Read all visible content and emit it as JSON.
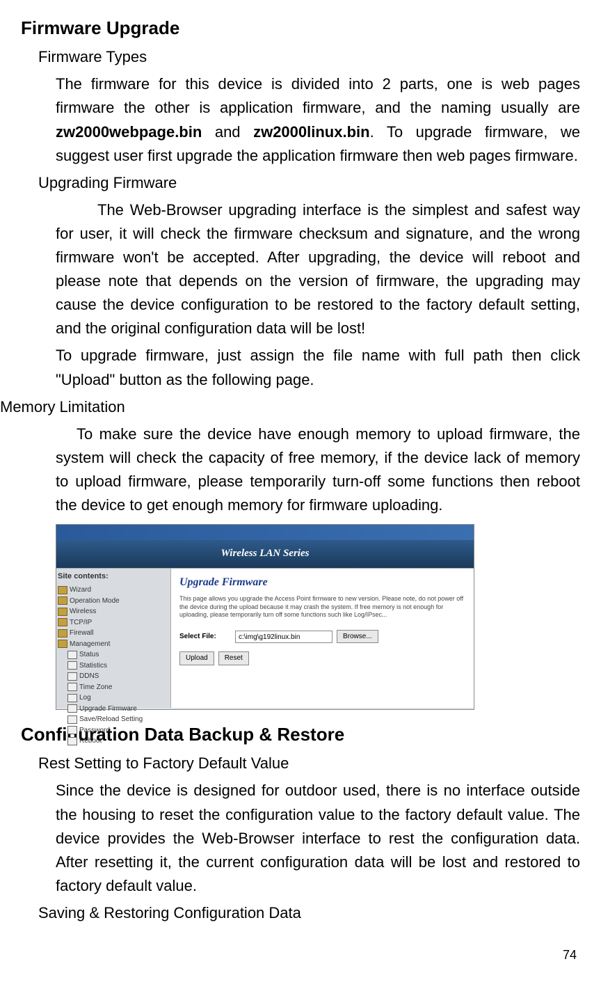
{
  "section1": {
    "title": "Firmware Upgrade",
    "sub1_title": "Firmware Types",
    "sub1_body": "The firmware for this device is divided into 2 parts, one is web pages firmware the other is application firmware, and the naming usually are ",
    "sub1_bold1": "zw2000webpage.bin",
    "sub1_mid": " and ",
    "sub1_bold2": "zw2000linux.bin",
    "sub1_end": ". To upgrade firmware, we suggest user first upgrade the application firmware then web pages firmware.",
    "sub2_title": "Upgrading Firmware",
    "sub2_body": "The Web-Browser upgrading interface is the simplest and safest way for user, it will check the firmware checksum and signature, and the wrong firmware won't be accepted. After upgrading, the device will reboot and please note that depends on the version of firmware, the upgrading may cause the device configuration to be restored to the factory default setting, and the original configuration data will be lost!",
    "sub2_body2": "To upgrade firmware, just assign the file name with full path then click \"Upload\" button as the following page.",
    "sub3_title": "Memory Limitation",
    "sub3_body": "To make sure the device have enough memory to upload firmware, the system will check the capacity of free memory, if the device lack of memory to upload firmware, please temporarily turn-off some functions then reboot the device to get enough memory for firmware uploading."
  },
  "screenshot": {
    "banner": "Wireless LAN Series",
    "sidebar_title": "Site contents:",
    "tree": {
      "wizard": "Wizard",
      "operation_mode": "Operation Mode",
      "wireless": "Wireless",
      "tcpip": "TCP/IP",
      "firewall": "Firewall",
      "management": "Management",
      "status": "Status",
      "statistics": "Statistics",
      "ddns": "DDNS",
      "time_zone": "Time Zone",
      "log": "Log",
      "upgrade_firmware": "Upgrade Firmware",
      "save_reload": "Save/Reload Setting",
      "password": "Password",
      "reboot": "Reboot"
    },
    "content_title": "Upgrade Firmware",
    "content_desc": "This page allows you upgrade the Access Point firmware to new version. Please note, do not power off the device during the upload because it may crash the system. If free memory is not enough for uploading, please temporarily turn off some functions such like Log/IPsec...",
    "select_file_label": "Select File:",
    "file_value": "c:\\img\\g192linux.bin",
    "browse": "Browse...",
    "upload": "Upload",
    "reset": "Reset"
  },
  "section2": {
    "title": "Configuration Data Backup & Restore",
    "sub1_title": "Rest Setting to Factory Default Value",
    "sub1_body": "Since the device is designed for outdoor used, there is no interface outside the housing to reset the configuration value to the factory default value. The device provides the Web-Browser interface to rest the configuration data. After resetting it, the current configuration data will be lost and restored to factory default value.",
    "sub2_title": "Saving & Restoring Configuration Data"
  },
  "page_number": "74"
}
